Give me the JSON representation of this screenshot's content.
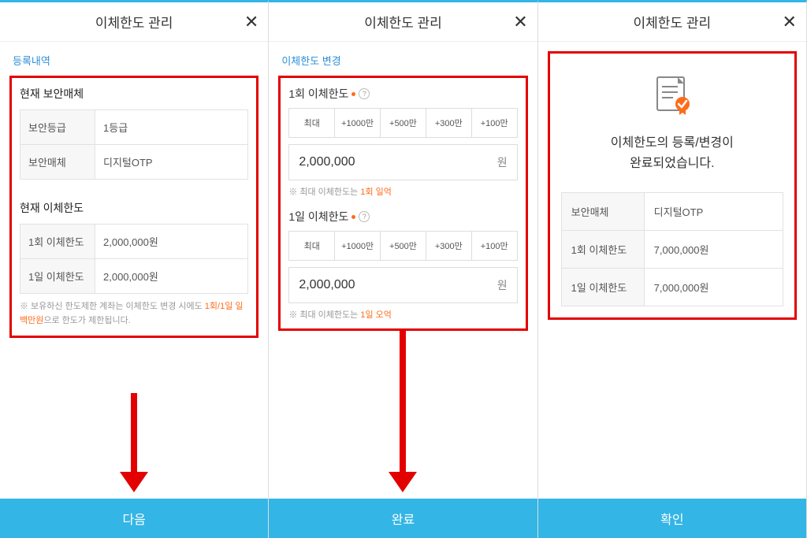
{
  "panel1": {
    "title": "이체한도 관리",
    "subheader": "등록내역",
    "section1_title": "현재 보안매체",
    "sec1_rows": [
      {
        "label": "보안등급",
        "value": "1등급"
      },
      {
        "label": "보안매체",
        "value": "디지털OTP"
      }
    ],
    "section2_title": "현재 이체한도",
    "sec2_rows": [
      {
        "label": "1회 이체한도",
        "value": "2,000,000원"
      },
      {
        "label": "1일 이체한도",
        "value": "2,000,000원"
      }
    ],
    "note_prefix": "※ 보유하신 한도제한 계좌는 이체한도 변경 시에도 ",
    "note_orange": "1회/1일 일백만원",
    "note_suffix": "으로 한도가 제한됩니다.",
    "footer": "다음"
  },
  "panel2": {
    "title": "이체한도 관리",
    "subheader": "이체한도 변경",
    "field1_label": "1회 이체한도",
    "amount_buttons": [
      "최대",
      "+1000만",
      "+500만",
      "+300만",
      "+100만"
    ],
    "input1_value": "2,000,000",
    "won": "원",
    "note1_prefix": "※ 최대 이체한도는 ",
    "note1_orange": "1회 일억",
    "field2_label": "1일 이체한도",
    "input2_value": "2,000,000",
    "note2_prefix": "※ 최대 이체한도는 ",
    "note2_orange": "1일 오억",
    "footer": "완료"
  },
  "panel3": {
    "title": "이체한도 관리",
    "success_line1": "이체한도의 등록/변경이",
    "success_line2": "완료되었습니다.",
    "rows": [
      {
        "label": "보안매체",
        "value": "디지털OTP"
      },
      {
        "label": "1회 이체한도",
        "value": "7,000,000원"
      },
      {
        "label": "1일 이체한도",
        "value": "7,000,000원"
      }
    ],
    "footer": "확인"
  }
}
